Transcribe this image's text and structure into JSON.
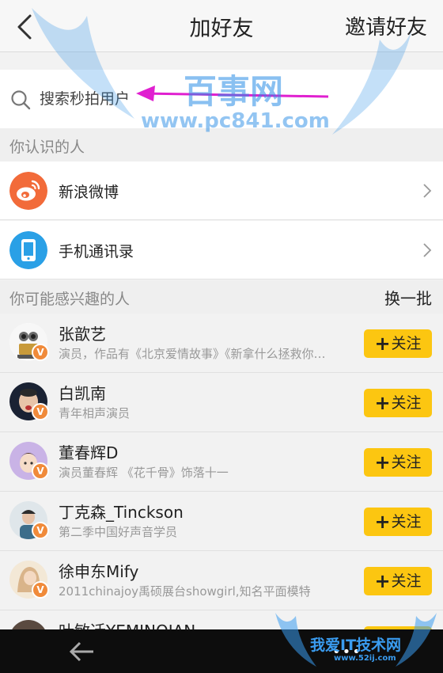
{
  "header": {
    "title": "加好友",
    "invite_label": "邀请好友"
  },
  "search": {
    "placeholder": "搜索秒拍用户"
  },
  "known_people": {
    "title": "你认识的人",
    "items": [
      {
        "label": "新浪微博",
        "icon": "weibo-icon",
        "color": "#f26b3a"
      },
      {
        "label": "手机通讯录",
        "icon": "phone-contacts-icon",
        "color": "#2aa0e6"
      }
    ]
  },
  "suggested": {
    "title": "你可能感兴趣的人",
    "refresh_label": "换一批",
    "follow_label": "关注",
    "users": [
      {
        "name": "张歆艺",
        "desc": "演员，作品有《北京爱情故事》《新拿什么拯救你我的爱人》"
      },
      {
        "name": "白凯南",
        "desc": "青年相声演员"
      },
      {
        "name": "董春辉D",
        "desc": "演员董春辉 《花千骨》饰落十一"
      },
      {
        "name": "丁克森_Tinckson",
        "desc": "第二季中国好声音学员"
      },
      {
        "name": "徐申东Mify",
        "desc": "2011chinajoy禹硕展台showgirl,知名平面模特"
      },
      {
        "name": "叶敏迁YEMINQIAN",
        "desc": ""
      }
    ]
  },
  "watermarks": {
    "top": "百事网",
    "top_url": "www.pc841.com",
    "bottom": "我爱IT技术网",
    "bottom_url": "www.52ij.com"
  },
  "colors": {
    "accent": "#fcc611",
    "badge": "#f08a3a",
    "weibo": "#f26b3a",
    "contacts": "#2aa0e6"
  }
}
